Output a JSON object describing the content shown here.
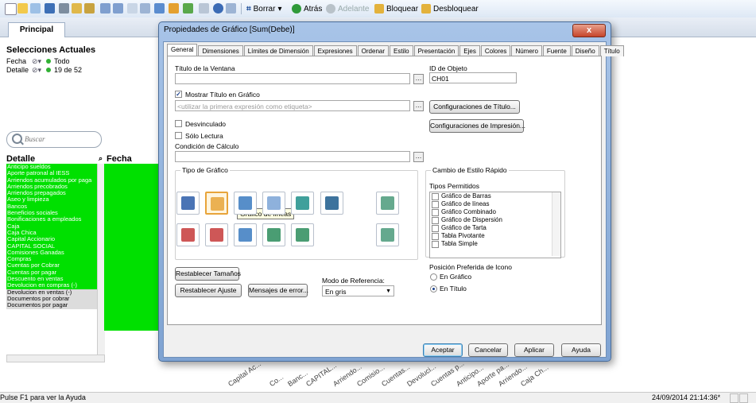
{
  "toolbar": {
    "borrar": "Borrar",
    "atras": "Atrás",
    "adelante": "Adelante",
    "bloquear": "Bloquear",
    "desbloquear": "Desbloquear"
  },
  "sheet": {
    "tab": "Principal",
    "selections_title": "Selecciones Actuales",
    "selections": [
      {
        "field": "Fecha",
        "value": "Todo"
      },
      {
        "field": "Detalle",
        "value": "19 de 52"
      }
    ],
    "search_placeholder": "Buscar",
    "list_header": "Detalle",
    "col2_header": "Fecha",
    "list_items": [
      {
        "text": "Anticipo sueldos",
        "state": "sel"
      },
      {
        "text": "Aporte patronal al IESS",
        "state": "sel"
      },
      {
        "text": "Arriendos acumulados por paga",
        "state": "sel"
      },
      {
        "text": "Arriendos precobrados",
        "state": "sel"
      },
      {
        "text": "Arriendos prepagados",
        "state": "sel"
      },
      {
        "text": "Aseo y limpieza",
        "state": "sel"
      },
      {
        "text": "Bancos",
        "state": "sel"
      },
      {
        "text": "Beneficios sociales",
        "state": "sel"
      },
      {
        "text": "Bonificaciones a empleados",
        "state": "sel"
      },
      {
        "text": "Caja",
        "state": "sel"
      },
      {
        "text": "Caja Chica",
        "state": "sel"
      },
      {
        "text": "Capital Accionario",
        "state": "sel"
      },
      {
        "text": "CAPITAL SOCIAL",
        "state": "sel"
      },
      {
        "text": "Comisiones Ganadas",
        "state": "sel"
      },
      {
        "text": "Compras",
        "state": "sel"
      },
      {
        "text": "Cuentas por Cobrar",
        "state": "sel"
      },
      {
        "text": "Cuentas por pagar",
        "state": "sel"
      },
      {
        "text": "Descuento en ventas",
        "state": "sel"
      },
      {
        "text": "Devolucion en compras (-)",
        "state": "sel"
      },
      {
        "text": "Devolucion en ventas (-)",
        "state": "alt"
      },
      {
        "text": "Documentos por cobrar",
        "state": "alt"
      },
      {
        "text": "Documentos por pagar",
        "state": "alt"
      }
    ],
    "chart_labels": [
      "Capital Ac...",
      "Co...",
      "Banc...",
      "CAPITAL...",
      "Arriendo...",
      "Comisio...",
      "Cuentas...",
      "Devoluci...",
      "Cuentas p...",
      "Anticipo...",
      "Aporte pa...",
      "Arriendo...",
      "Caja Ch..."
    ]
  },
  "dialog": {
    "title": "Propiedades de Gráfico [Sum(Debe)]",
    "close": "x",
    "tabs": [
      "General",
      "Dimensiones",
      "Límites de Dimensión",
      "Expresiones",
      "Ordenar",
      "Estilo",
      "Presentación",
      "Ejes",
      "Colores",
      "Número",
      "Fuente",
      "Diseño",
      "Título"
    ],
    "window_title_label": "Título de la Ventana",
    "window_title_value": "",
    "object_id_label": "ID de Objeto",
    "object_id_value": "CH01",
    "show_title_label": "Mostrar Título en Gráfico",
    "title_placeholder": "<utilizar la primera expresión como etiqueta>",
    "title_settings_btn": "Configuraciones de Título...",
    "print_settings_btn": "Configuraciones de Impresión...",
    "unlinked_label": "Desvinculado",
    "readonly_label": "Sólo Lectura",
    "calc_condition_label": "Condición de Cálculo",
    "chart_type_label": "Tipo de Gráfico",
    "tooltip": "Gráfico de líneas",
    "quick_change_label": "Cambio de Estilo Rápido",
    "allowed_types_label": "Tipos Permitidos",
    "allowed_types": [
      "Gráfico de Barras",
      "Gráfico de líneas",
      "Gráfico Combinado",
      "Gráfico de Dispersión",
      "Gráfico de Tarta",
      "Tabla Pivotante",
      "Tabla Simple"
    ],
    "icon_pos_label": "Posición Preferida de Icono",
    "in_chart": "En Gráfico",
    "in_title": "En Título",
    "reset_sizes_btn": "Restablecer Tamaños",
    "reset_fit_btn": "Restablecer Ajuste",
    "error_msgs_btn": "Mensajes de error...",
    "ref_mode_label": "Modo de Referencia:",
    "ref_mode_value": "En gris",
    "accept": "Aceptar",
    "cancel": "Cancelar",
    "apply": "Aplicar",
    "help": "Ayuda"
  },
  "status": {
    "left": "Pulse F1 para ver la Ayuda",
    "right": "24/09/2014 21:14:36*"
  }
}
